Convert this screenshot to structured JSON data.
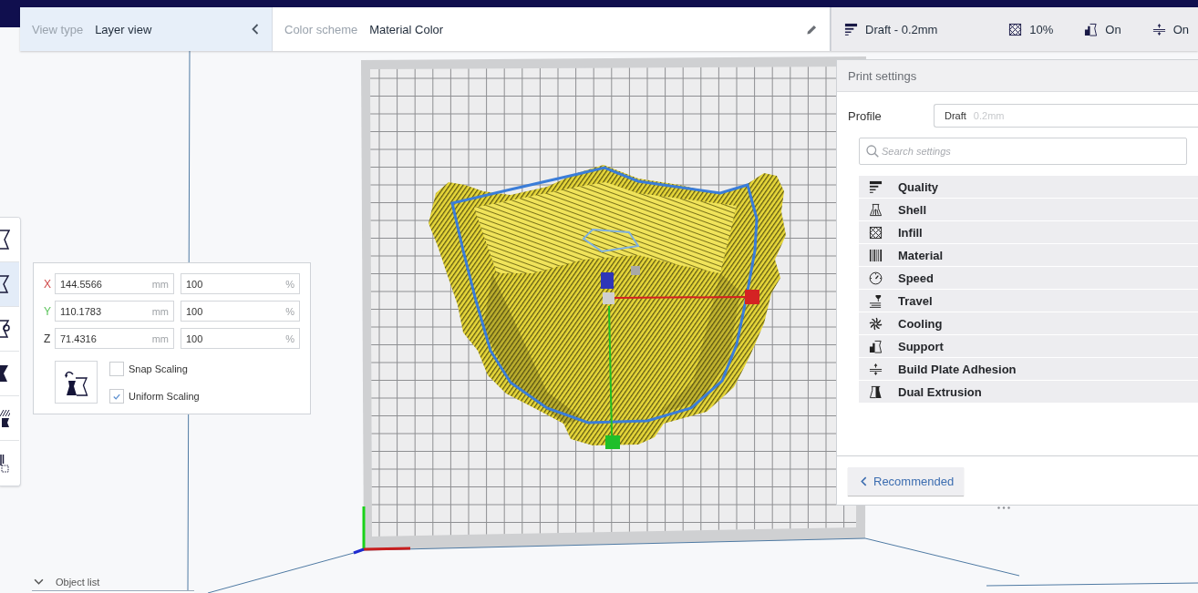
{
  "view_bar": {
    "view_type": {
      "label": "View type",
      "value": "Layer view"
    },
    "color_scheme": {
      "label": "Color scheme",
      "value": "Material Color"
    }
  },
  "print_setup": [
    {
      "kind": "quality",
      "value": "Draft - 0.2mm"
    },
    {
      "kind": "infill",
      "value": "10%"
    },
    {
      "kind": "support",
      "value": "On"
    },
    {
      "kind": "adhesion",
      "value": "On"
    }
  ],
  "toolbar": [
    {
      "kind": "move",
      "selected": false
    },
    {
      "kind": "scale",
      "selected": true
    },
    {
      "kind": "rotate",
      "selected": false
    },
    {
      "kind": "mirror",
      "selected": false
    },
    {
      "kind": "per_model",
      "selected": false
    },
    {
      "kind": "support_blocker",
      "selected": false
    }
  ],
  "scale_panel": {
    "rows": [
      {
        "axis": "X",
        "color": "#d04848",
        "size": "144.5566",
        "size_unit": "mm",
        "percent": "100",
        "percent_unit": "%"
      },
      {
        "axis": "Y",
        "color": "#5cc45c",
        "size": "110.1783",
        "size_unit": "mm",
        "percent": "100",
        "percent_unit": "%"
      },
      {
        "axis": "Z",
        "color": "#333333",
        "size": "71.4316",
        "size_unit": "mm",
        "percent": "100",
        "percent_unit": "%"
      }
    ],
    "options": [
      {
        "label": "Snap Scaling",
        "checked": false
      },
      {
        "label": "Uniform Scaling",
        "checked": true
      }
    ]
  },
  "print_settings": {
    "title": "Print settings",
    "profile": {
      "label": "Profile",
      "name": "Draft",
      "detail": "0.2mm"
    },
    "search": {
      "placeholder": "Search settings"
    },
    "categories": [
      {
        "kind": "quality",
        "label": "Quality"
      },
      {
        "kind": "shell",
        "label": "Shell"
      },
      {
        "kind": "infill",
        "label": "Infill"
      },
      {
        "kind": "material",
        "label": "Material"
      },
      {
        "kind": "speed",
        "label": "Speed"
      },
      {
        "kind": "travel",
        "label": "Travel"
      },
      {
        "kind": "cooling",
        "label": "Cooling"
      },
      {
        "kind": "support",
        "label": "Support"
      },
      {
        "kind": "adhesion",
        "label": "Build Plate Adhesion"
      },
      {
        "kind": "dual",
        "label": "Dual Extrusion"
      }
    ],
    "mode_button": "Recommended"
  },
  "object_list": {
    "label": "Object list"
  }
}
